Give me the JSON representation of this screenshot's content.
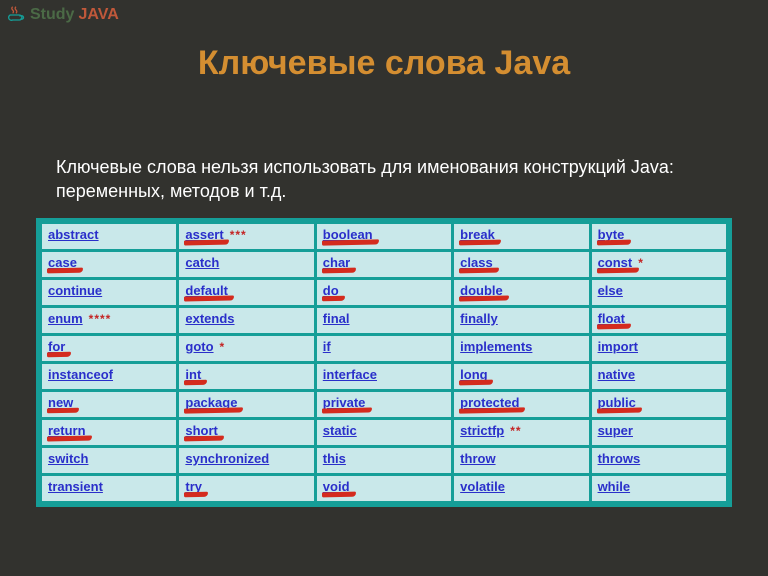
{
  "logo": {
    "study": "Study",
    "java": "JAVA"
  },
  "title": "Ключевые слова Java",
  "description": "Ключевые слова нельзя использовать для именования конструкций Java: переменных, методов и т.д.",
  "table": [
    [
      {
        "w": "abstract"
      },
      {
        "w": "assert",
        "note": "***",
        "mark": true
      },
      {
        "w": "boolean",
        "mark": true
      },
      {
        "w": "break",
        "mark": true
      },
      {
        "w": "byte",
        "mark": true
      }
    ],
    [
      {
        "w": "case",
        "mark": true
      },
      {
        "w": "catch"
      },
      {
        "w": "char",
        "mark": true
      },
      {
        "w": "class",
        "mark": true
      },
      {
        "w": "const",
        "note": "*",
        "mark": true
      }
    ],
    [
      {
        "w": "continue"
      },
      {
        "w": "default",
        "mark": true
      },
      {
        "w": "do",
        "mark": true
      },
      {
        "w": "double",
        "mark": true
      },
      {
        "w": "else"
      }
    ],
    [
      {
        "w": "enum",
        "note": "****"
      },
      {
        "w": "extends"
      },
      {
        "w": "final"
      },
      {
        "w": "finally"
      },
      {
        "w": "float",
        "mark": true
      }
    ],
    [
      {
        "w": "for",
        "mark": true
      },
      {
        "w": "goto",
        "note": "*"
      },
      {
        "w": "if"
      },
      {
        "w": "implements"
      },
      {
        "w": "import"
      }
    ],
    [
      {
        "w": "instanceof"
      },
      {
        "w": "int",
        "mark": true
      },
      {
        "w": "interface"
      },
      {
        "w": "long",
        "mark": true
      },
      {
        "w": "native"
      }
    ],
    [
      {
        "w": "new",
        "mark": true
      },
      {
        "w": "package",
        "mark": true
      },
      {
        "w": "private",
        "mark": true
      },
      {
        "w": "protected",
        "mark": true
      },
      {
        "w": "public",
        "mark": true
      }
    ],
    [
      {
        "w": "return",
        "mark": true
      },
      {
        "w": "short",
        "mark": true
      },
      {
        "w": "static"
      },
      {
        "w": "strictfp",
        "note": "**"
      },
      {
        "w": "super"
      }
    ],
    [
      {
        "w": "switch"
      },
      {
        "w": "synchronized"
      },
      {
        "w": "this"
      },
      {
        "w": "throw"
      },
      {
        "w": "throws"
      }
    ],
    [
      {
        "w": "transient"
      },
      {
        "w": "try",
        "mark": true
      },
      {
        "w": "void",
        "mark": true
      },
      {
        "w": "volatile"
      },
      {
        "w": "while"
      }
    ]
  ]
}
